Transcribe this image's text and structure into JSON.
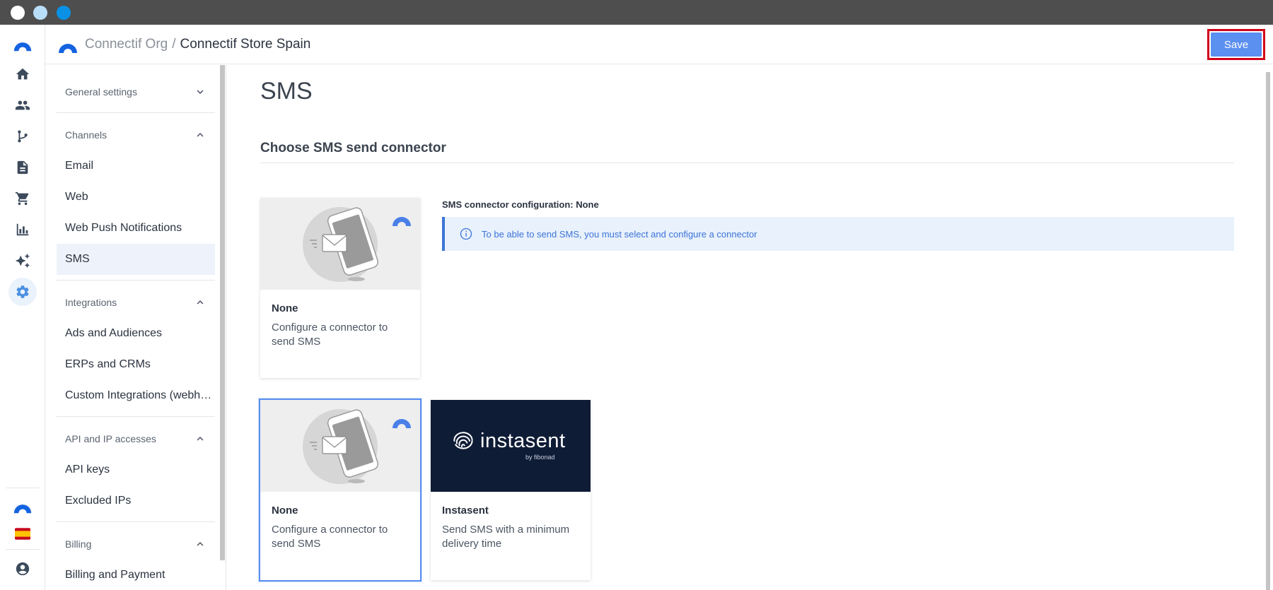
{
  "header": {
    "org_name": "Connectif Org",
    "separator": "/",
    "store_name": "Connectif Store Spain",
    "save_label": "Save"
  },
  "rail": {
    "items": [
      "home-icon",
      "users-icon",
      "workflow-icon",
      "document-icon",
      "cart-icon",
      "bar-chart-icon",
      "sparkles-icon",
      "gear-icon"
    ],
    "active": "gear-icon",
    "bottom": [
      "connectif-logo",
      "spain-flag-icon",
      "account-icon"
    ]
  },
  "sidebar": {
    "sections": [
      {
        "label": "General settings",
        "expanded": false,
        "items": []
      },
      {
        "label": "Channels",
        "expanded": true,
        "items": [
          "Email",
          "Web",
          "Web Push Notifications",
          "SMS"
        ]
      },
      {
        "label": "Integrations",
        "expanded": true,
        "items": [
          "Ads and Audiences",
          "ERPs and CRMs",
          "Custom Integrations (webh…"
        ]
      },
      {
        "label": "API and IP accesses",
        "expanded": true,
        "items": [
          "API keys",
          "Excluded IPs"
        ]
      },
      {
        "label": "Billing",
        "expanded": true,
        "items": [
          "Billing and Payment"
        ]
      }
    ],
    "active_item": "SMS"
  },
  "main": {
    "title": "SMS",
    "section_title": "Choose SMS send connector",
    "current_card": {
      "name": "None",
      "description": "Configure a connector to send SMS"
    },
    "config_label": "SMS connector configuration: None",
    "info_text": "To be able to send SMS, you must select and configure a connector",
    "options": [
      {
        "name": "None",
        "description": "Configure a connector to send SMS",
        "selected": true
      },
      {
        "name": "Instasent",
        "description": "Send SMS with a minimum delivery time",
        "selected": false,
        "logo_text": "instasent",
        "logo_sub": "by fibonad"
      }
    ]
  },
  "colors": {
    "accent": "#5b8ff0",
    "info_bg": "#e8f1fc",
    "info_text": "#3d74d6",
    "highlight_border": "#d0021b"
  }
}
